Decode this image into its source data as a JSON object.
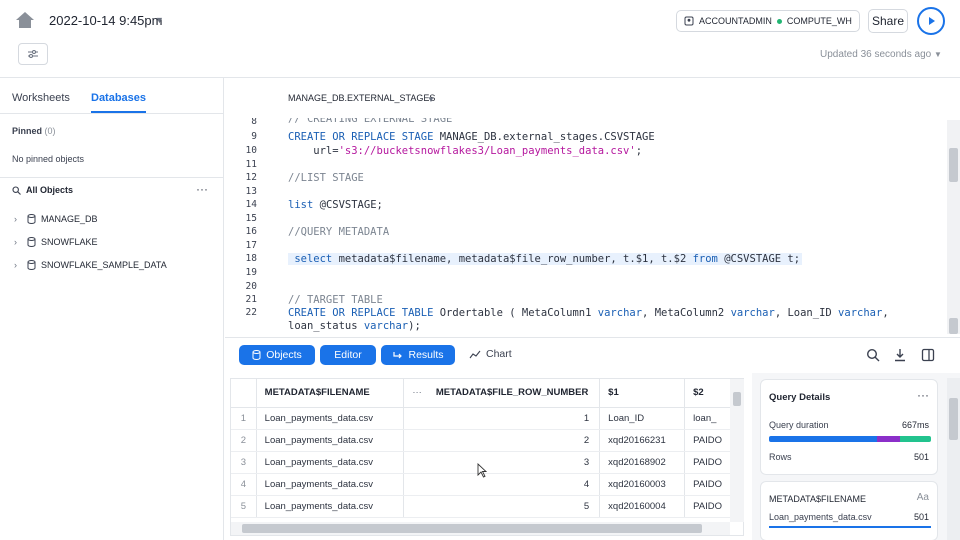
{
  "header": {
    "worksheet_title": "2022-10-14 9:45pm",
    "role": "ACCOUNTADMIN",
    "warehouse": "COMPUTE_WH",
    "share_label": "Share",
    "updated_text": "Updated 36 seconds ago"
  },
  "sidebar": {
    "tabs": [
      "Worksheets",
      "Databases"
    ],
    "pinned_label": "Pinned",
    "pinned_count": "(0)",
    "no_pinned": "No pinned objects",
    "all_objects": "All Objects",
    "databases": [
      "MANAGE_DB",
      "SNOWFLAKE",
      "SNOWFLAKE_SAMPLE_DATA"
    ]
  },
  "editor": {
    "context": "MANAGE_DB.EXTERNAL_STAGES"
  },
  "results_toolbar": {
    "objects_label": "Objects",
    "editor_label": "Editor",
    "results_label": "Results",
    "chart_label": "Chart"
  },
  "grid": {
    "columns": [
      "METADATA$FILENAME",
      "METADATA$FILE_ROW_NUMBER",
      "$1",
      "$2"
    ],
    "ellipsis": "···",
    "rows": [
      {
        "idx": "1",
        "filename": "Loan_payments_data.csv",
        "rownum": "1",
        "c1": "Loan_ID",
        "c2": "loan_"
      },
      {
        "idx": "2",
        "filename": "Loan_payments_data.csv",
        "rownum": "2",
        "c1": "xqd20166231",
        "c2": "PAIDO"
      },
      {
        "idx": "3",
        "filename": "Loan_payments_data.csv",
        "rownum": "3",
        "c1": "xqd20168902",
        "c2": "PAIDO"
      },
      {
        "idx": "4",
        "filename": "Loan_payments_data.csv",
        "rownum": "4",
        "c1": "xqd20160003",
        "c2": "PAIDO"
      },
      {
        "idx": "5",
        "filename": "Loan_payments_data.csv",
        "rownum": "5",
        "c1": "xqd20160004",
        "c2": "PAIDO"
      }
    ]
  },
  "details": {
    "query_title": "Query Details",
    "duration_label": "Query duration",
    "duration_value": "667ms",
    "rows_label": "Rows",
    "rows_value": "501",
    "column_title": "METADATA$FILENAME",
    "column_type": "Aa",
    "column_value": "Loan_payments_data.csv",
    "column_count": "501",
    "bar_colors": [
      "#1a73e8",
      "#8b2fc9",
      "#22c38e"
    ]
  }
}
